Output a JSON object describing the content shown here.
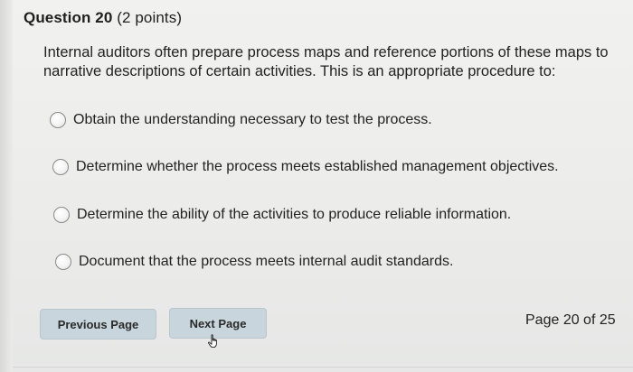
{
  "question": {
    "number_label": "Question 20",
    "points_label": "(2 points)",
    "text": "Internal auditors often prepare process maps and reference portions of these maps to narrative descriptions of certain activities. This is an appropriate procedure to:"
  },
  "options": [
    {
      "label": "Obtain the understanding necessary to test the process.",
      "selected": false
    },
    {
      "label": "Determine whether the process meets established management objectives.",
      "selected": false
    },
    {
      "label": "Determine the ability of the activities to produce reliable information.",
      "selected": false
    },
    {
      "label": "Document that the process meets internal audit standards.",
      "selected": false
    }
  ],
  "navigation": {
    "previous_label": "Previous Page",
    "next_label": "Next Page",
    "page_indicator": "Page 20 of 25"
  },
  "icons": {
    "radio": "radio-unchecked-icon",
    "cursor": "hand-pointer-icon"
  },
  "colors": {
    "background": "#eeeeec",
    "button_bg": "#c8d5dd",
    "text": "#222222"
  }
}
